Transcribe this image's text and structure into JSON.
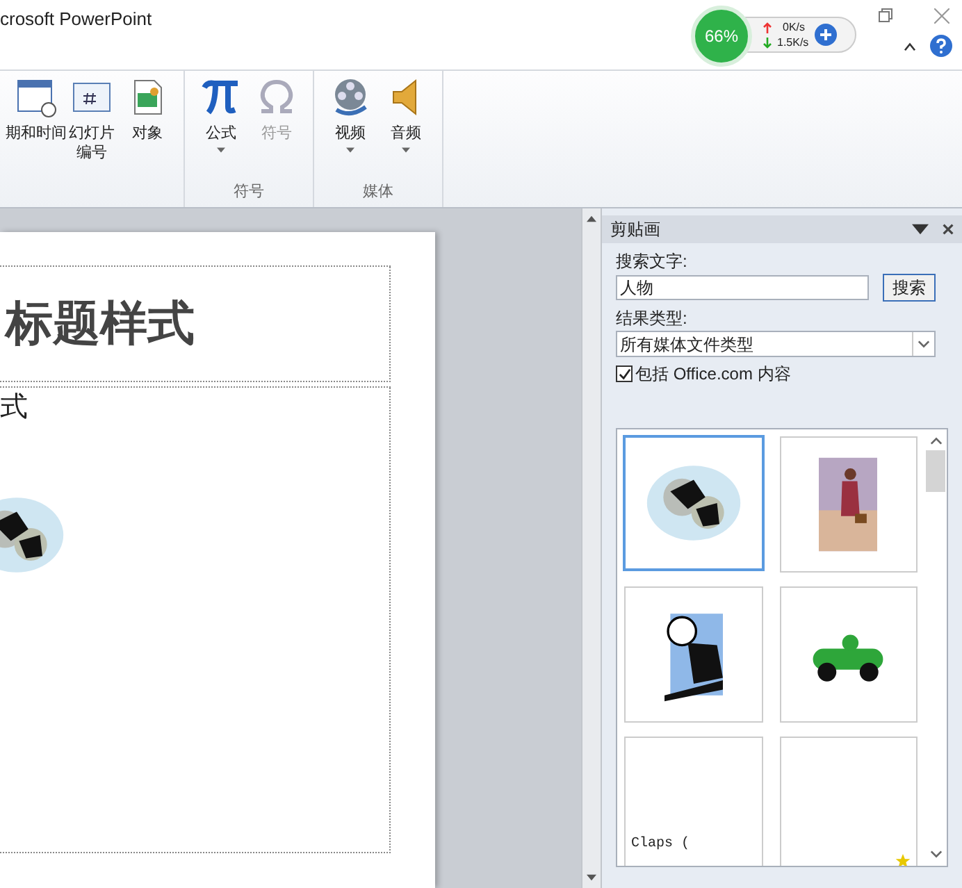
{
  "window": {
    "title": "crosoft PowerPoint"
  },
  "net_widget": {
    "percent": "66%",
    "upload": "0K/s",
    "download": "1.5K/s"
  },
  "ribbon": {
    "groups": [
      {
        "items": [
          {
            "kind": "calendar",
            "label": "期和时间",
            "dropdown": false,
            "disabled": false
          },
          {
            "kind": "number",
            "label": "幻灯片编号",
            "dropdown": false,
            "disabled": false
          },
          {
            "kind": "object",
            "label": "对象",
            "dropdown": false,
            "disabled": false
          }
        ]
      },
      {
        "label": "符号",
        "items": [
          {
            "kind": "pi",
            "label": "公式",
            "dropdown": true,
            "disabled": false
          },
          {
            "kind": "omega",
            "label": "符号",
            "dropdown": false,
            "disabled": true
          }
        ]
      },
      {
        "label": "媒体",
        "items": [
          {
            "kind": "video",
            "label": "视频",
            "dropdown": true,
            "disabled": false
          },
          {
            "kind": "audio",
            "label": "音频",
            "dropdown": true,
            "disabled": false
          }
        ]
      }
    ]
  },
  "slide": {
    "title": "标题样式",
    "body": "式"
  },
  "clip_pane": {
    "title": "剪贴画",
    "search_label": "搜索文字:",
    "search_value": "人物",
    "search_button": "搜索",
    "type_label": "结果类型:",
    "type_value": "所有媒体文件类型",
    "include_label": "包括 Office.com 内容",
    "include_checked": true,
    "results": [
      {
        "kind": "picture",
        "selected": true
      },
      {
        "kind": "picture",
        "selected": false
      },
      {
        "kind": "picture",
        "selected": false
      },
      {
        "kind": "picture",
        "selected": false
      },
      {
        "kind": "caption",
        "caption": "Claps (",
        "selected": false
      },
      {
        "kind": "star",
        "selected": false
      }
    ]
  }
}
